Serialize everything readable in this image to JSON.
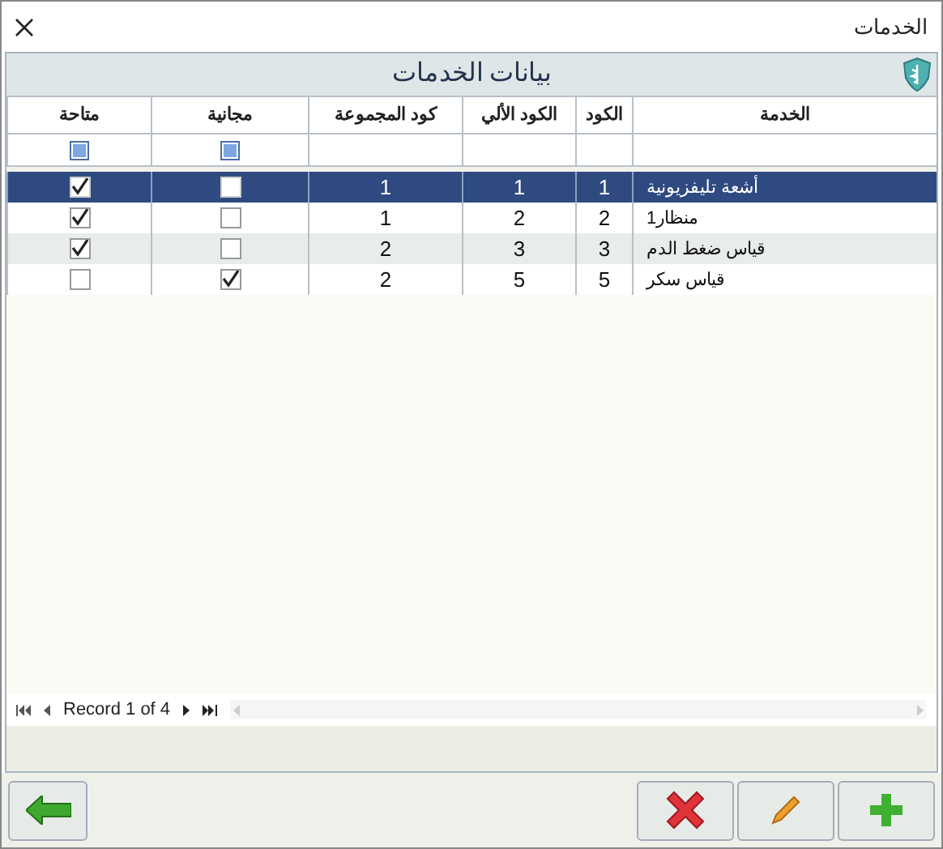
{
  "window": {
    "title": "الخدمات"
  },
  "panel": {
    "title": "بيانات الخدمات"
  },
  "table": {
    "columns": [
      "الخدمة",
      "الكود",
      "الكود الألي",
      "كود المجموعة",
      "مجانية",
      "متاحة"
    ],
    "rows": [
      {
        "service": "أشعة تليفزيونية",
        "code": "1",
        "auto_code": "1",
        "group_code": "1",
        "free": false,
        "available": true,
        "selected": true
      },
      {
        "service": "منظار1",
        "code": "2",
        "auto_code": "2",
        "group_code": "1",
        "free": false,
        "available": true,
        "selected": false
      },
      {
        "service": "قياس ضغط الدم",
        "code": "3",
        "auto_code": "3",
        "group_code": "2",
        "free": false,
        "available": true,
        "selected": false
      },
      {
        "service": "قياس سكر",
        "code": "5",
        "auto_code": "5",
        "group_code": "2",
        "free": true,
        "available": false,
        "selected": false
      }
    ]
  },
  "filters": [
    {
      "indeterminate": true
    },
    {
      "indeterminate": true
    }
  ],
  "navigator": {
    "record_text": "Record 1 of 4"
  }
}
